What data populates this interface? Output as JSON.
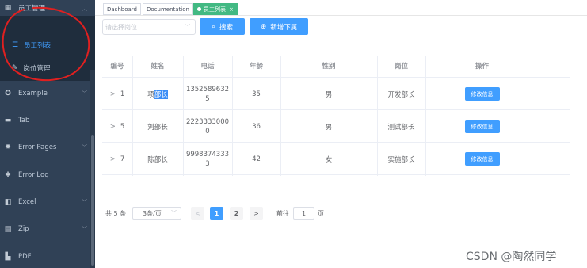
{
  "sidebar": {
    "group": {
      "label": "员工管理",
      "icon": "table-icon"
    },
    "sub_items": [
      {
        "label": "员工列表",
        "icon": "list-icon",
        "active": true
      },
      {
        "label": "岗位管理",
        "icon": "edit-icon",
        "active": false
      }
    ],
    "items": [
      {
        "label": "Example",
        "icon": "gear-icon",
        "has_arrow": true
      },
      {
        "label": "Tab",
        "icon": "tab-icon",
        "has_arrow": false
      },
      {
        "label": "Error Pages",
        "icon": "bug-icon",
        "has_arrow": true
      },
      {
        "label": "Error Log",
        "icon": "bug-icon",
        "has_arrow": false
      },
      {
        "label": "Excel",
        "icon": "excel-icon",
        "has_arrow": true
      },
      {
        "label": "Zip",
        "icon": "zip-icon",
        "has_arrow": true
      },
      {
        "label": "PDF",
        "icon": "pdf-icon",
        "has_arrow": false
      }
    ]
  },
  "tags": [
    {
      "label": "Dashboard",
      "active": false
    },
    {
      "label": "Documentation",
      "active": false
    },
    {
      "label": "员工列表",
      "active": true,
      "close": "×"
    }
  ],
  "filter": {
    "select_placeholder": "请选择岗位",
    "search_label": "搜索",
    "add_label": "新增下属"
  },
  "table": {
    "columns": [
      "编号",
      "姓名",
      "电话",
      "年龄",
      "性别",
      "岗位",
      "操作"
    ],
    "rows": [
      {
        "expand": ">",
        "id": "1",
        "name_pre": "项",
        "name_hl": "部长",
        "phone": "13525896325",
        "age": "35",
        "gender": "男",
        "post": "开发部长",
        "action": "修改信息"
      },
      {
        "expand": ">",
        "id": "5",
        "name_pre": "刘部长",
        "name_hl": "",
        "phone": "22233330000",
        "age": "36",
        "gender": "男",
        "post": "测试部长",
        "action": "修改信息"
      },
      {
        "expand": ">",
        "id": "7",
        "name_pre": "陈部长",
        "name_hl": "",
        "phone": "99983743333",
        "age": "42",
        "gender": "女",
        "post": "实施部长",
        "action": "修改信息"
      }
    ]
  },
  "pagination": {
    "total": "共 5 条",
    "page_size": "3条/页",
    "prev": "<",
    "pages": [
      "1",
      "2"
    ],
    "current": "1",
    "next": ">",
    "goto_label": "前往",
    "goto_value": "1",
    "goto_suffix": "页"
  },
  "watermark": "CSDN @陶然同学",
  "colors": {
    "sidebar_bg": "#304156",
    "submenu_bg": "#1f2d3d",
    "accent": "#409eff",
    "active_tag": "#42b983",
    "annotation": "#e02020"
  }
}
